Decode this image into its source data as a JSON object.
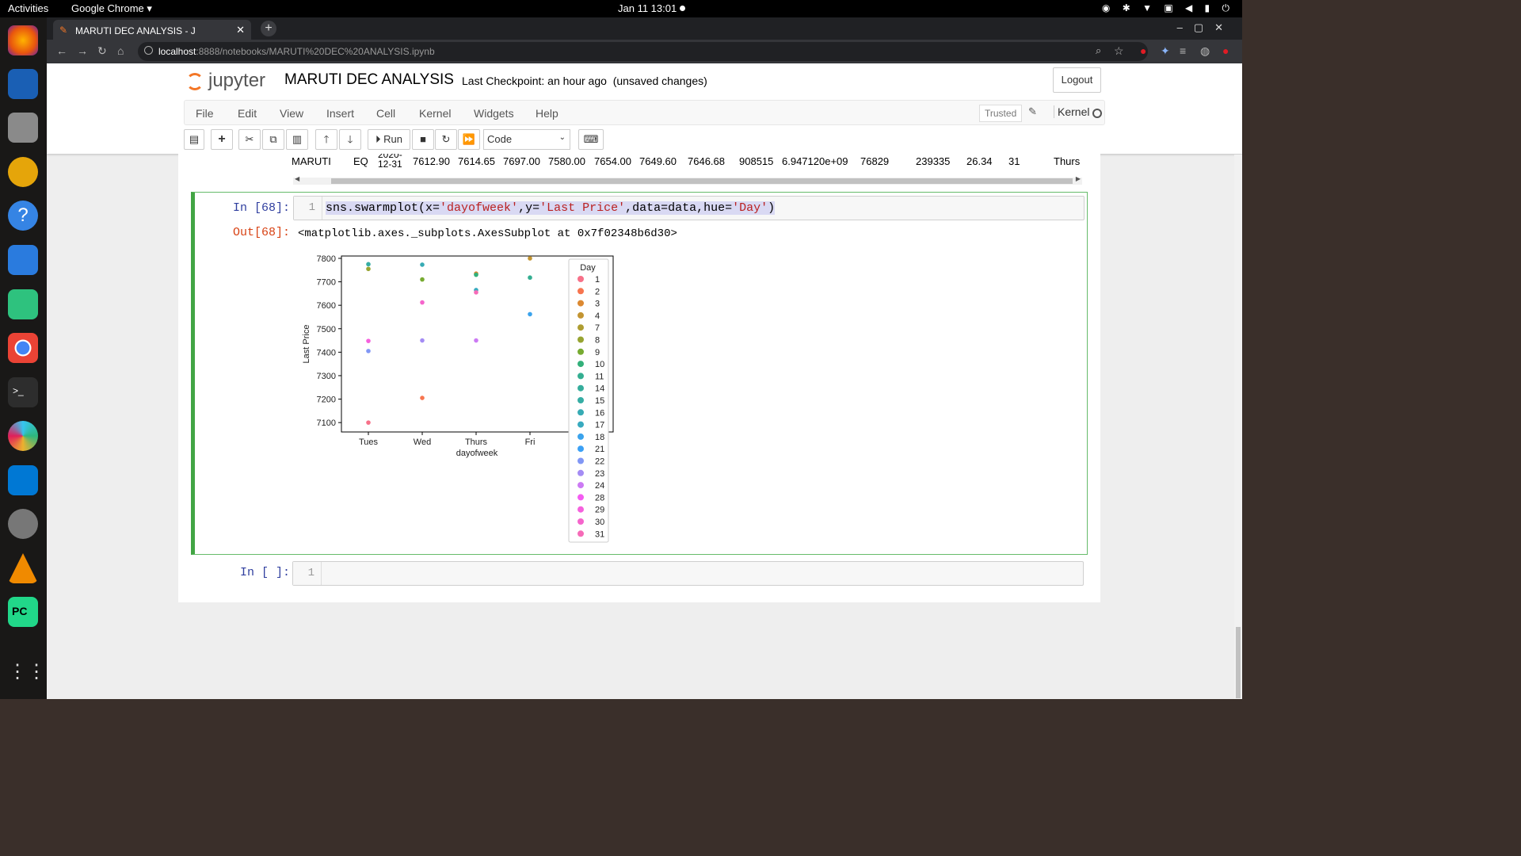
{
  "system": {
    "activities": "Activities",
    "app_menu": "Google Chrome",
    "clock": "Jan 11  13:01"
  },
  "browser": {
    "tab_title": "MARUTI DEC ANALYSIS - J",
    "url_host": "localhost",
    "url_path": ":8888/notebooks/MARUTI%20DEC%20ANALYSIS.ipynb"
  },
  "jupyter": {
    "logo_text": "jupyter",
    "notebook_title": "MARUTI DEC ANALYSIS",
    "checkpoint": "Last Checkpoint: an hour ago",
    "unsaved": "(unsaved changes)",
    "logout": "Logout",
    "menu": [
      "File",
      "Edit",
      "View",
      "Insert",
      "Cell",
      "Kernel",
      "Widgets",
      "Help"
    ],
    "trusted": "Trusted",
    "kernel_label": "Kernel",
    "toolbar": {
      "run": "Run",
      "cell_type": "Code"
    }
  },
  "dataframe_row": [
    "MARUTI",
    "EQ",
    "2020-12-31",
    "7612.90",
    "7614.65",
    "7697.00",
    "7580.00",
    "7654.00",
    "7649.60",
    "7646.68",
    "908515",
    "6.947120e+09",
    "76829",
    "239335",
    "26.34",
    "31",
    "Thurs"
  ],
  "cell68": {
    "in_prompt": "In [68]:",
    "line_no": "1",
    "code_prefix": "sns.swarmplot(x=",
    "code_s1": "'dayofweek'",
    "code_mid1": ",y=",
    "code_s2": "'Last Price'",
    "code_mid2": ",data=data,hue=",
    "code_s3": "'Day'",
    "code_suffix": ")",
    "out_prompt": "Out[68]:",
    "out_text": "<matplotlib.axes._subplots.AxesSubplot at 0x7f02348b6d30>"
  },
  "next_cell": {
    "in_prompt": "In [ ]:",
    "line_no": "1"
  },
  "chart_data": {
    "type": "scatter",
    "xlabel": "dayofweek",
    "ylabel": "Last Price",
    "categories": [
      "Tues",
      "Wed",
      "Thurs",
      "Fri"
    ],
    "ylim": [
      7060,
      7810
    ],
    "yticks": [
      7100,
      7200,
      7300,
      7400,
      7500,
      7600,
      7700,
      7800
    ],
    "legend_title": "Day",
    "legend_position": "right (overflowing axes)",
    "legend": [
      {
        "day": "1",
        "color": "#f77189"
      },
      {
        "day": "2",
        "color": "#f7754f"
      },
      {
        "day": "3",
        "color": "#dc8932"
      },
      {
        "day": "4",
        "color": "#c39532"
      },
      {
        "day": "7",
        "color": "#ae9d31"
      },
      {
        "day": "8",
        "color": "#97a431"
      },
      {
        "day": "9",
        "color": "#77ab31"
      },
      {
        "day": "10",
        "color": "#33b07a"
      },
      {
        "day": "11",
        "color": "#34ae91"
      },
      {
        "day": "14",
        "color": "#35ad9c"
      },
      {
        "day": "15",
        "color": "#36ada4"
      },
      {
        "day": "16",
        "color": "#37abb4"
      },
      {
        "day": "17",
        "color": "#38aabf"
      },
      {
        "day": "18",
        "color": "#3ba3ec"
      },
      {
        "day": "21",
        "color": "#3ba0f5"
      },
      {
        "day": "22",
        "color": "#8197f5"
      },
      {
        "day": "23",
        "color": "#a48cf4"
      },
      {
        "day": "24",
        "color": "#cc7af4"
      },
      {
        "day": "28",
        "color": "#f45cf2"
      },
      {
        "day": "29",
        "color": "#f561dd"
      },
      {
        "day": "30",
        "color": "#f565cc"
      },
      {
        "day": "31",
        "color": "#f66bb8"
      }
    ],
    "points": [
      {
        "x": "Tues",
        "y": 7775,
        "day": "15"
      },
      {
        "x": "Tues",
        "y": 7755,
        "day": "8"
      },
      {
        "x": "Tues",
        "y": 7448,
        "day": "29"
      },
      {
        "x": "Tues",
        "y": 7405,
        "day": "22"
      },
      {
        "x": "Tues",
        "y": 7100,
        "day": "1"
      },
      {
        "x": "Wed",
        "y": 7773,
        "day": "16"
      },
      {
        "x": "Wed",
        "y": 7710,
        "day": "9"
      },
      {
        "x": "Wed",
        "y": 7612,
        "day": "30"
      },
      {
        "x": "Wed",
        "y": 7450,
        "day": "23"
      },
      {
        "x": "Wed",
        "y": 7205,
        "day": "2"
      },
      {
        "x": "Thurs",
        "y": 7735,
        "day": "3"
      },
      {
        "x": "Thurs",
        "y": 7730,
        "day": "10"
      },
      {
        "x": "Thurs",
        "y": 7665,
        "day": "17"
      },
      {
        "x": "Thurs",
        "y": 7655,
        "day": "31"
      },
      {
        "x": "Thurs",
        "y": 7450,
        "day": "24"
      },
      {
        "x": "Fri",
        "y": 7800,
        "day": "4"
      },
      {
        "x": "Fri",
        "y": 7718,
        "day": "11"
      },
      {
        "x": "Fri",
        "y": 7562,
        "day": "18"
      }
    ]
  }
}
